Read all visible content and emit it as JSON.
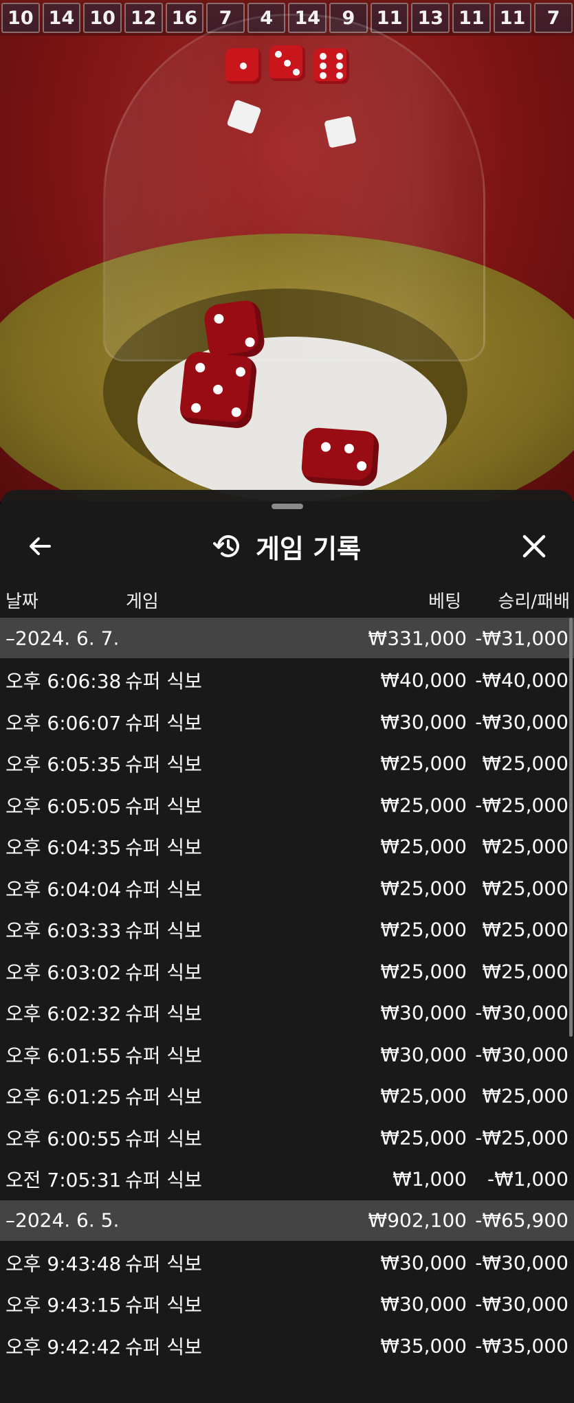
{
  "history_strip": [
    "10",
    "14",
    "10",
    "12",
    "16",
    "7",
    "4",
    "14",
    "9",
    "11",
    "13",
    "11",
    "11",
    "7"
  ],
  "panel": {
    "title": "게임 기록",
    "columns": {
      "date": "날짜",
      "game": "게임",
      "bet": "베팅",
      "result": "승리/패배"
    },
    "groups": [
      {
        "label": "–2024. 6. 7.",
        "bet": "₩331,000",
        "result": "-₩31,000",
        "rows": [
          {
            "time": "오후 6:06:38",
            "game": "슈퍼 식보",
            "bet": "₩40,000",
            "result": "-₩40,000"
          },
          {
            "time": "오후 6:06:07",
            "game": "슈퍼 식보",
            "bet": "₩30,000",
            "result": "-₩30,000"
          },
          {
            "time": "오후 6:05:35",
            "game": "슈퍼 식보",
            "bet": "₩25,000",
            "result": "₩25,000"
          },
          {
            "time": "오후 6:05:05",
            "game": "슈퍼 식보",
            "bet": "₩25,000",
            "result": "-₩25,000"
          },
          {
            "time": "오후 6:04:35",
            "game": "슈퍼 식보",
            "bet": "₩25,000",
            "result": "₩25,000"
          },
          {
            "time": "오후 6:04:04",
            "game": "슈퍼 식보",
            "bet": "₩25,000",
            "result": "₩25,000"
          },
          {
            "time": "오후 6:03:33",
            "game": "슈퍼 식보",
            "bet": "₩25,000",
            "result": "₩25,000"
          },
          {
            "time": "오후 6:03:02",
            "game": "슈퍼 식보",
            "bet": "₩25,000",
            "result": "₩25,000"
          },
          {
            "time": "오후 6:02:32",
            "game": "슈퍼 식보",
            "bet": "₩30,000",
            "result": "-₩30,000"
          },
          {
            "time": "오후 6:01:55",
            "game": "슈퍼 식보",
            "bet": "₩30,000",
            "result": "-₩30,000"
          },
          {
            "time": "오후 6:01:25",
            "game": "슈퍼 식보",
            "bet": "₩25,000",
            "result": "₩25,000"
          },
          {
            "time": "오후 6:00:55",
            "game": "슈퍼 식보",
            "bet": "₩25,000",
            "result": "-₩25,000"
          },
          {
            "time": "오전 7:05:31",
            "game": "슈퍼 식보",
            "bet": "₩1,000",
            "result": "-₩1,000"
          }
        ]
      },
      {
        "label": "–2024. 6. 5.",
        "bet": "₩902,100",
        "result": "-₩65,900",
        "rows": [
          {
            "time": "오후 9:43:48",
            "game": "슈퍼 식보",
            "bet": "₩30,000",
            "result": "-₩30,000"
          },
          {
            "time": "오후 9:43:15",
            "game": "슈퍼 식보",
            "bet": "₩30,000",
            "result": "-₩30,000"
          },
          {
            "time": "오후 9:42:42",
            "game": "슈퍼 식보",
            "bet": "₩35,000",
            "result": "-₩35,000"
          }
        ]
      }
    ]
  }
}
